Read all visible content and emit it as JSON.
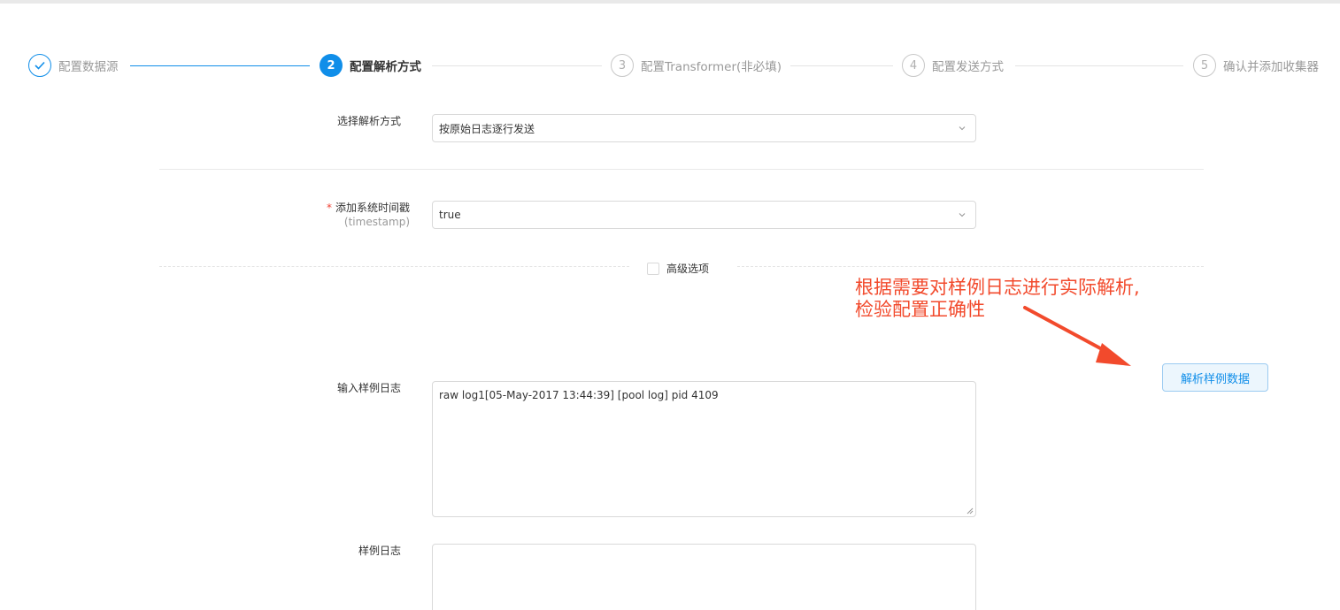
{
  "steps": [
    {
      "number": "",
      "label": "配置数据源",
      "state": "done",
      "icon": "check-icon"
    },
    {
      "number": "2",
      "label": "配置解析方式",
      "state": "active"
    },
    {
      "number": "3",
      "label": "配置Transformer(非必填)",
      "state": "wait"
    },
    {
      "number": "4",
      "label": "配置发送方式",
      "state": "wait"
    },
    {
      "number": "5",
      "label": "确认并添加收集器",
      "state": "wait"
    }
  ],
  "form": {
    "parse_mode": {
      "label": "选择解析方式",
      "value": "按原始日志逐行发送"
    },
    "timestamp": {
      "required_mark": "*",
      "label": "添加系统时间戳",
      "sub_label": "(timestamp)",
      "value": "true"
    },
    "advanced": {
      "label": "高级选项",
      "checked": false
    },
    "sample_input": {
      "label": "输入样例日志",
      "value": "raw log1[05-May-2017 13:44:39]  [pool log] pid 4109"
    },
    "sample_log": {
      "label": "样例日志",
      "value": ""
    }
  },
  "parse_button": {
    "label": "解析样例数据"
  },
  "annotation": {
    "line1": "根据需要对样例日志进行实际解析,",
    "line2": "检验配置正确性",
    "color": "#f24a2c"
  },
  "colors": {
    "primary": "#108ee9",
    "border": "#d9d9d9"
  }
}
